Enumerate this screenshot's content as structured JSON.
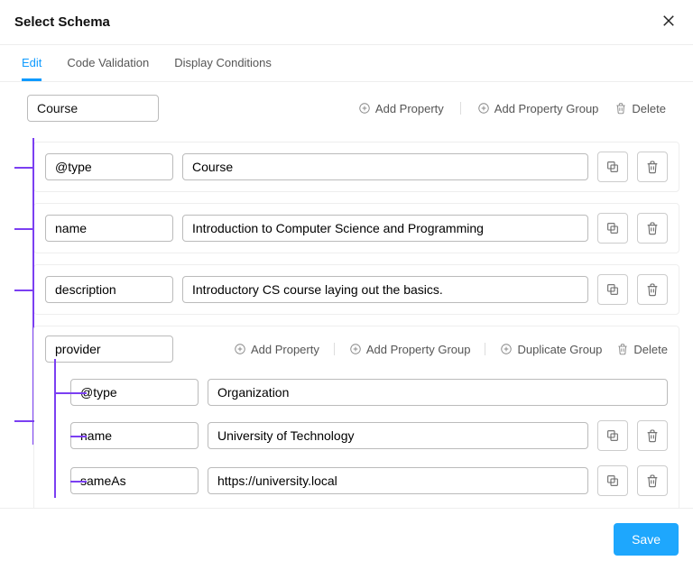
{
  "modal": {
    "title": "Select Schema"
  },
  "tabs": {
    "edit": "Edit",
    "code_validation": "Code Validation",
    "display_conditions": "Display Conditions"
  },
  "actions": {
    "add_property": "Add Property",
    "add_group": "Add Property Group",
    "duplicate_group": "Duplicate Group",
    "delete": "Delete"
  },
  "schema": {
    "root_name": "Course",
    "props": [
      {
        "key": "@type",
        "value": "Course"
      },
      {
        "key": "name",
        "value": "Introduction to Computer Science and Programming"
      },
      {
        "key": "description",
        "value": "Introductory CS course laying out the basics."
      }
    ],
    "group": {
      "name": "provider",
      "props": [
        {
          "key": "@type",
          "value": "Organization"
        },
        {
          "key": "name",
          "value": "University of Technology"
        },
        {
          "key": "sameAs",
          "value": "https://university.local"
        }
      ]
    }
  },
  "footer": {
    "save": "Save"
  }
}
